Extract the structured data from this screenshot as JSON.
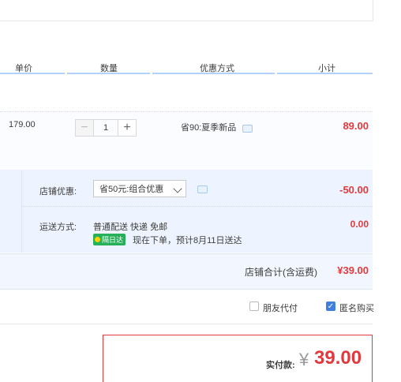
{
  "columns": {
    "unit_price": "单价",
    "quantity": "数量",
    "discount": "优惠方式",
    "subtotal": "小计"
  },
  "item": {
    "price": "179.00",
    "quantity": "1",
    "decrease_symbol": "−",
    "increase_symbol": "+",
    "promo": "省90:夏季新品",
    "subtotal": "89.00"
  },
  "shop": {
    "discount_label": "店铺优惠:",
    "discount_selected": "省50元:组合优惠",
    "discount_amount": "-50.00",
    "shipping_label": "运送方式:",
    "shipping_method": "普通配送 快递 免邮",
    "badge": "隔日达",
    "delivery_note": "现在下单，预计8月11日送达",
    "shipping_amount": "0.00"
  },
  "total": {
    "label": "店铺合计(含运费)",
    "amount": "¥39.00"
  },
  "options": {
    "friend_pay_label": "朋友代付",
    "friend_pay_checked": false,
    "anonymous_label": "匿名购买",
    "anonymous_checked": true
  },
  "payment": {
    "label": "实付款:",
    "currency": "¥",
    "amount": "39.00"
  },
  "colors": {
    "price_red": "#e4393c",
    "header_line": "#b2d1ff",
    "badge_green": "#27b05a",
    "checkbox_blue": "#3f7fe0"
  }
}
